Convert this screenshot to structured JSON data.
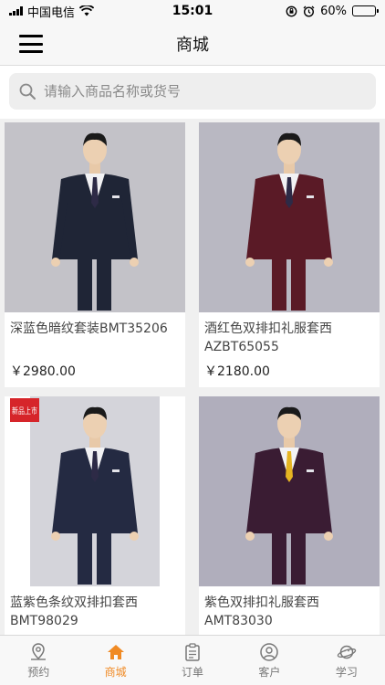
{
  "status_bar": {
    "carrier": "中国电信",
    "time": "15:01",
    "battery_text": "60%",
    "battery_level": 0.6
  },
  "nav": {
    "title": "商城"
  },
  "search": {
    "placeholder": "请输入商品名称或货号"
  },
  "products": [
    {
      "name": "深蓝色暗纹套装BMT35206",
      "price": "￥2980.00",
      "suit_color": "#1f2536",
      "bg": "#c3c2c8"
    },
    {
      "name": "酒红色双排扣礼服套西AZBT65055",
      "price": "￥2180.00",
      "suit_color": "#5a1a26",
      "bg": "#b9b8c2"
    },
    {
      "name": "蓝紫色条纹双排扣套西BMT98029",
      "price": "",
      "suit_color": "#242a42",
      "bg": "#d4d4da",
      "badge": "新品上市"
    },
    {
      "name": "紫色双排扣礼服套西AMT83030",
      "price": "",
      "suit_color": "#3a1c33",
      "bg": "#b0aebc"
    }
  ],
  "tabs": [
    {
      "label": "预约",
      "icon": "location-pin-icon",
      "active": false
    },
    {
      "label": "商城",
      "icon": "home-icon",
      "active": true
    },
    {
      "label": "订单",
      "icon": "clipboard-icon",
      "active": false
    },
    {
      "label": "客户",
      "icon": "user-icon",
      "active": false
    },
    {
      "label": "学习",
      "icon": "planet-icon",
      "active": false
    }
  ],
  "colors": {
    "accent": "#f08a24",
    "tab_inactive": "#777777"
  }
}
